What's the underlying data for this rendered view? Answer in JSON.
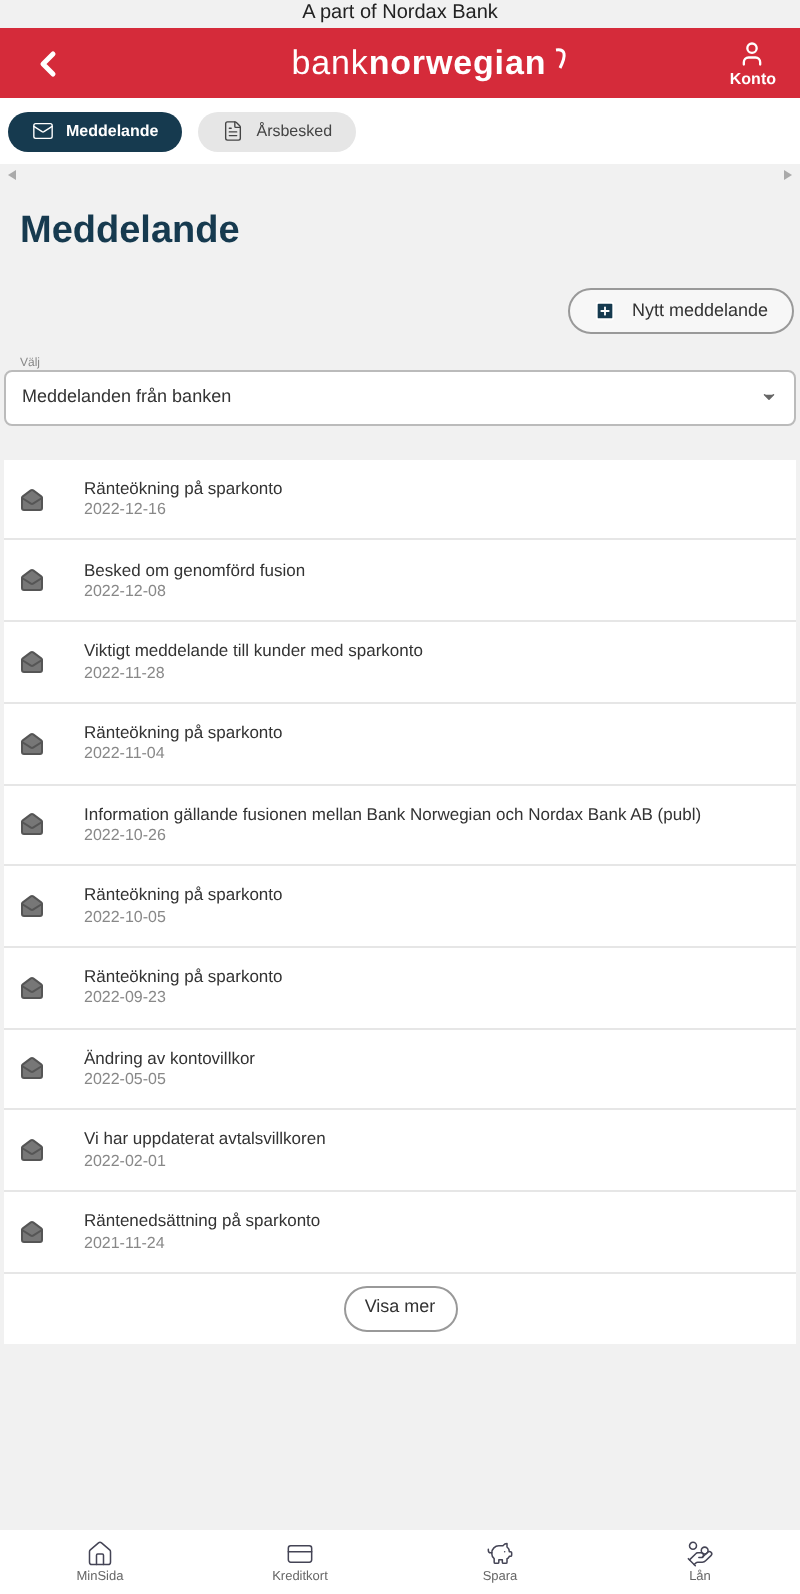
{
  "top_banner": "A part of Nordax Bank",
  "header": {
    "logo": "bank**norwegian**",
    "account_label": "Konto"
  },
  "tabs": [
    {
      "label": "Meddelande",
      "selected": true,
      "kind": "mail"
    },
    {
      "label": "Årsbesked",
      "selected": false,
      "kind": "document"
    }
  ],
  "page_title": "Meddelande",
  "new_message_button": "Nytt meddelande",
  "filter": {
    "label": "Välj",
    "value": "Meddelanden från banken"
  },
  "messages": [
    {
      "title": "Ränteökning på sparkonto",
      "date": "2022-12-16"
    },
    {
      "title": "Besked om genomförd fusion",
      "date": "2022-12-08"
    },
    {
      "title": "Viktigt meddelande till kunder med sparkonto",
      "date": "2022-11-28"
    },
    {
      "title": "Ränteökning på sparkonto",
      "date": "2022-11-04"
    },
    {
      "title": "Information gällande fusionen mellan Bank Norwegian och Nordax Bank AB (publ)",
      "date": "2022-10-26"
    },
    {
      "title": "Ränteökning på sparkonto",
      "date": "2022-10-05"
    },
    {
      "title": "Ränteökning på sparkonto",
      "date": "2022-09-23"
    },
    {
      "title": "Ändring av kontovillkor",
      "date": "2022-05-05"
    },
    {
      "title": "Vi har uppdaterat avtalsvillkoren",
      "date": "2022-02-01"
    },
    {
      "title": "Räntenedsättning på sparkonto",
      "date": "2021-11-24"
    }
  ],
  "show_more_button": "Visa mer",
  "bottom_nav": [
    {
      "label": "MinSida",
      "kind": "home"
    },
    {
      "label": "Kreditkort",
      "kind": "card"
    },
    {
      "label": "Spara",
      "kind": "savings"
    },
    {
      "label": "Lån",
      "kind": "loan"
    }
  ]
}
